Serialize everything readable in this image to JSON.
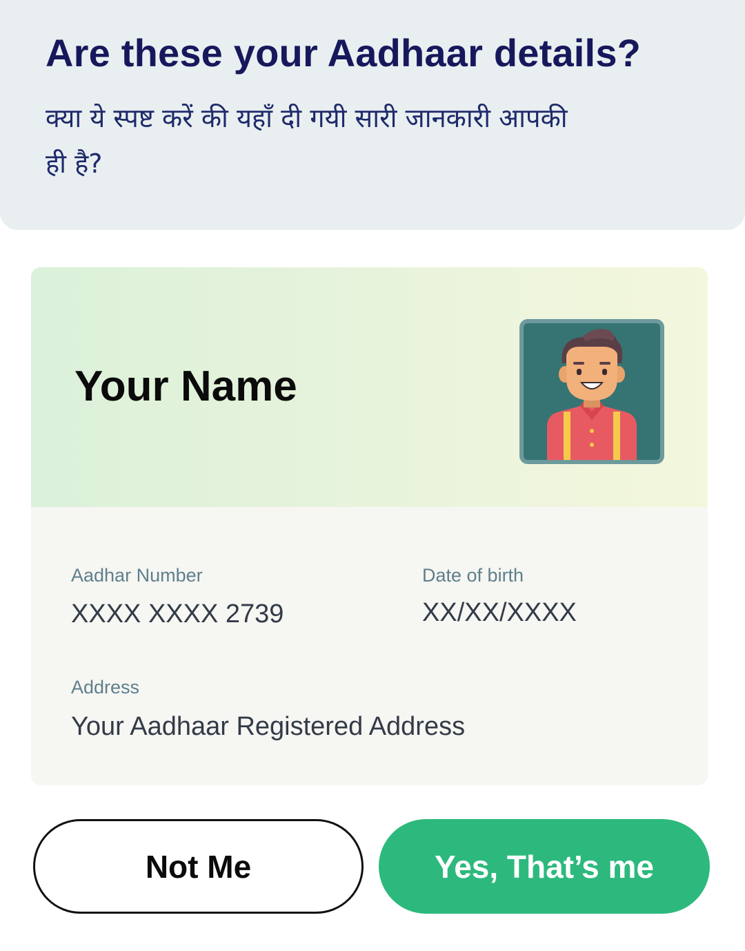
{
  "header": {
    "title": "Are these your Aadhaar details?",
    "subtitle": "क्या ये स्पष्ट करें की यहाँ दी गयी सारी जानकारी आपकी ही है?"
  },
  "card": {
    "name": "Your Name",
    "avatar_icon": "person-avatar-icon",
    "aadhar_number_label": "Aadhar Number",
    "aadhar_number_value": "XXXX XXXX 2739",
    "dob_label": "Date of birth",
    "dob_value": "XX/XX/XXXX",
    "address_label": "Address",
    "address_value": "Your Aadhaar Registered Address"
  },
  "actions": {
    "not_me_label": "Not Me",
    "confirm_label": "Yes, That’s me"
  },
  "colors": {
    "title": "#17185c",
    "header_bg": "#e9eff0",
    "confirm_bg": "#2db97d",
    "label": "#5f7f8c"
  }
}
